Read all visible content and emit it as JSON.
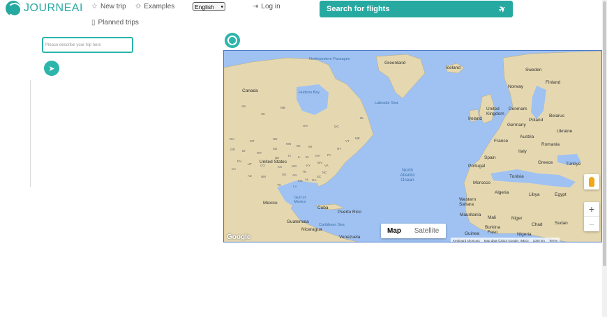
{
  "brand": {
    "name": "JOURNEAI",
    "color": "#26a9a0"
  },
  "nav": {
    "new_trip": "New trip",
    "new_trip_icon": "star-icon",
    "examples": "Examples",
    "examples_icon": "sparkle-icon",
    "planned_trips": "Planned trips",
    "planned_trips_icon": "bookmark-icon",
    "login": "Log in",
    "login_icon": "login-icon"
  },
  "language": {
    "selected": "English"
  },
  "flights": {
    "label": "Search for flights",
    "icon": "plane-icon"
  },
  "trip": {
    "placeholder": "Please describe your trip here"
  },
  "map": {
    "labels": {
      "northwest_passages": "Northwestern Passages",
      "greenland": "Greenland",
      "iceland": "Iceland",
      "sweden": "Sweden",
      "finland": "Finland",
      "norway": "Norway",
      "canada": "Canada",
      "hudson_bay": "Hudson Bay",
      "labrador_sea": "Labrador Sea",
      "united_kingdom": "United Kingdom",
      "denmark": "Denmark",
      "belarus": "Belarus",
      "ireland": "Ireland",
      "poland": "Poland",
      "germany": "Germany",
      "ukraine": "Ukraine",
      "austria": "Austria",
      "france": "France",
      "romania": "Romania",
      "italy": "Italy",
      "spain": "Spain",
      "greece": "Greece",
      "turkiye": "Türkiye",
      "portugal": "Portugal",
      "united_states": "United States",
      "north_atlantic_ocean": "North Atlantic Ocean",
      "tunisia": "Tunisia",
      "morocco": "Morocco",
      "algeria": "Algeria",
      "libya": "Libya",
      "egypt": "Egypt",
      "mexico": "Mexico",
      "gulf_of_mexico": "Gulf of Mexico",
      "cuba": "Cuba",
      "puerto_rico": "Puerto Rico",
      "western_sahara": "Western Sahara",
      "mauritania": "Mauritania",
      "mali": "Mali",
      "niger": "Niger",
      "chad": "Chad",
      "sudan": "Sudan",
      "guatemala": "Guatemala",
      "caribbean_sea": "Caribbean Sea",
      "nicaragua": "Nicaragua",
      "venezuela": "Venezuela",
      "guinea": "Guinea",
      "burkina_faso": "Burkina Faso",
      "nigeria": "Nigeria",
      "ab": "AB",
      "sk": "SK",
      "mb": "MB",
      "on": "ON",
      "qc": "QC",
      "nl": "NL",
      "wa": "WA",
      "mt": "MT",
      "nd": "ND",
      "mn": "MN",
      "or": "OR",
      "id": "ID",
      "wy": "WY",
      "sd": "SD",
      "ne": "NE",
      "ia": "IA",
      "nv": "NV",
      "ut": "UT",
      "co": "CO",
      "ks": "KS",
      "mo": "MO",
      "il": "IL",
      "in": "IN",
      "oh": "OH",
      "ca": "CA",
      "az": "AZ",
      "nm": "NM",
      "ok": "OK",
      "tx": "TX",
      "ar": "AR",
      "ms": "MS",
      "al": "AL",
      "ga": "GA",
      "la": "LA",
      "ky": "KY",
      "tn": "TN",
      "wv": "WV",
      "va": "VA",
      "nc": "NC",
      "sc": "SC",
      "pa": "PA",
      "ny": "NY",
      "mi": "MI",
      "wi": "WI",
      "me": "ME",
      "vt": "VT"
    },
    "map_type": {
      "map": "Map",
      "satellite": "Satellite"
    },
    "zoom": {
      "in": "+",
      "out": "−"
    },
    "google": "Google",
    "attribution": {
      "shortcuts": "Keyboard shortcuts",
      "data": "Map data ©2024 Google, INEGI",
      "scale": "1000 km",
      "terms": "Terms"
    },
    "colors": {
      "water": "#9fc2f2",
      "land": "#e5d8b0",
      "border": "#4a78c9"
    }
  },
  "accent_color": "#2bb5ab"
}
